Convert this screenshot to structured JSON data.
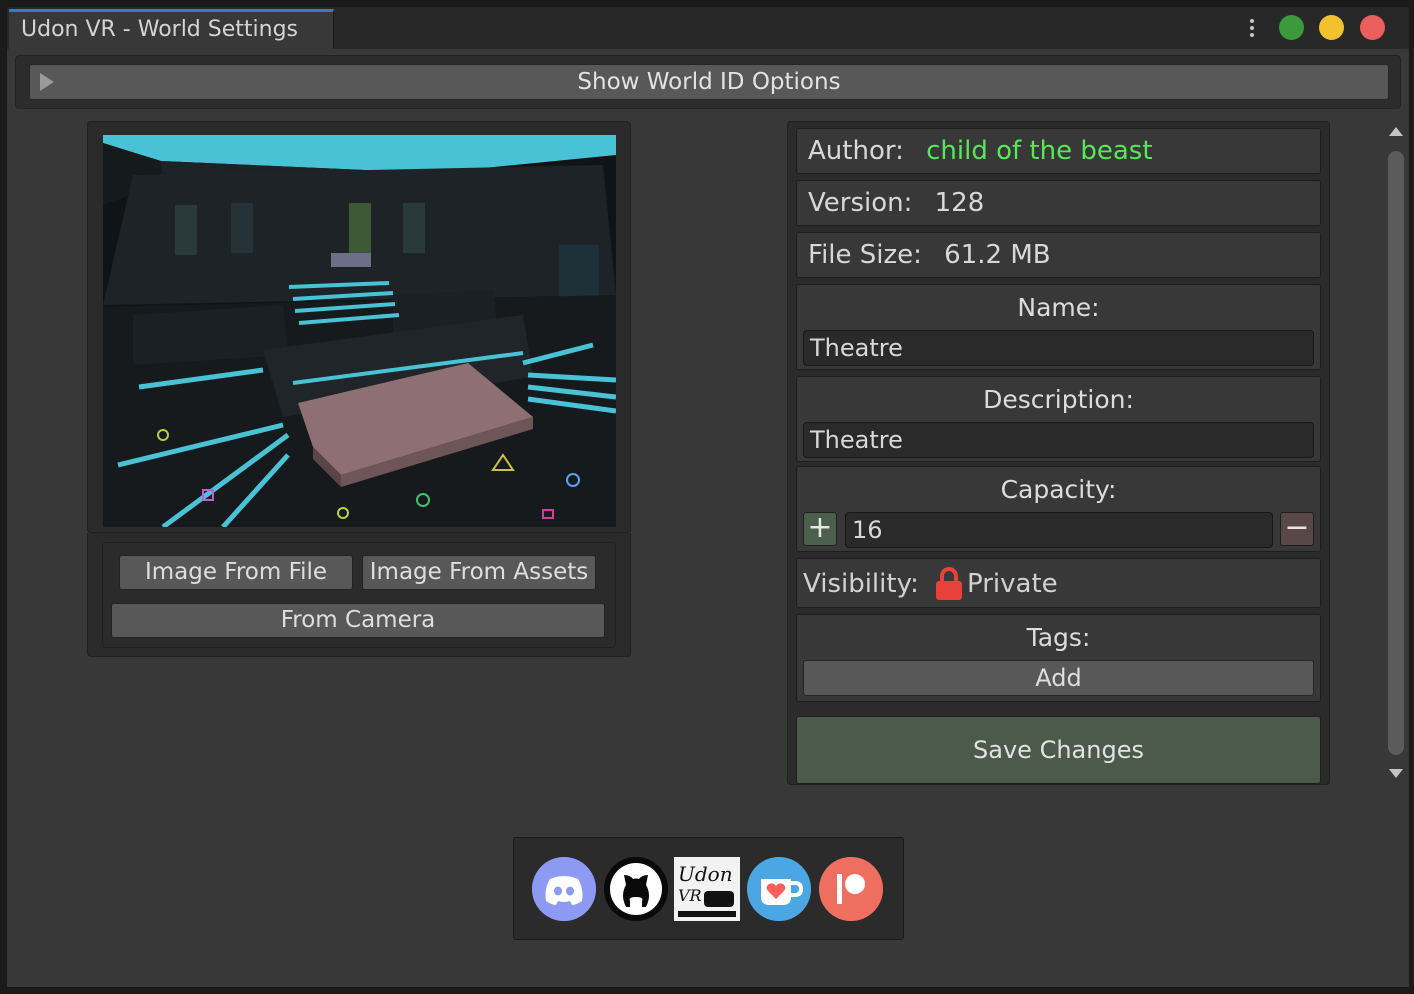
{
  "window": {
    "title": "Udon VR - World Settings",
    "controls": [
      "menu-dots-icon",
      "green-light",
      "yellow-light",
      "red-light"
    ]
  },
  "world_id": {
    "toggle_label": "Show World ID Options"
  },
  "image": {
    "buttons": {
      "from_file": "Image From File",
      "from_assets": "Image From Assets",
      "from_camera": "From Camera"
    }
  },
  "info": {
    "author_label": "Author:",
    "author_value": "child of the beast",
    "version_label": "Version:",
    "version_value": "128",
    "filesize_label": "File Size:",
    "filesize_value": "61.2 MB"
  },
  "form": {
    "name_label": "Name:",
    "name_value": "Theatre",
    "description_label": "Description:",
    "description_value": "Theatre",
    "capacity_label": "Capacity:",
    "capacity_value": "16",
    "capacity_plus": "+",
    "capacity_minus": "−",
    "visibility_label": "Visibility:",
    "visibility_value": "Private",
    "tags_label": "Tags:",
    "tags_add": "Add",
    "save": "Save Changes"
  },
  "colors": {
    "accent_tab": "#3d78c8",
    "author": "#58e758",
    "save_button": "#4b5a4a",
    "lock": "#e8403a"
  },
  "social": {
    "icons": [
      "discord-icon",
      "github-icon",
      "udon-vr-logo",
      "kofi-icon",
      "patreon-icon"
    ],
    "udon_logo_text": "Udon VR"
  }
}
